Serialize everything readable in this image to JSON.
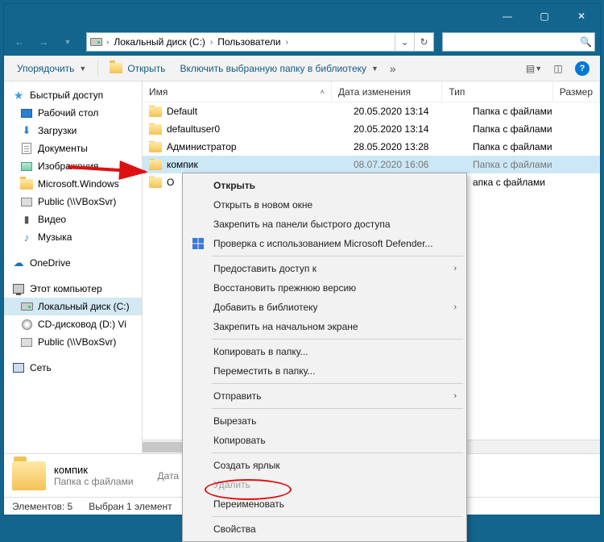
{
  "titlebar": {
    "min": "—",
    "max": "▢",
    "close": "✕"
  },
  "breadcrumbs": [
    "Локальный диск (C:)",
    "Пользователи"
  ],
  "search_placeholder": "",
  "toolbar": {
    "organize": "Упорядочить",
    "open": "Открыть",
    "include": "Включить выбранную папку в библиотеку",
    "overflow": "»"
  },
  "columns": {
    "name": "Имя",
    "date": "Дата изменения",
    "type": "Тип",
    "size": "Размер"
  },
  "rows": [
    {
      "name": "Default",
      "date": "20.05.2020 13:14",
      "type": "Папка с файлами"
    },
    {
      "name": "defaultuser0",
      "date": "20.05.2020 13:14",
      "type": "Папка с файлами"
    },
    {
      "name": "Администратор",
      "date": "28.05.2020 13:28",
      "type": "Папка с файлами"
    },
    {
      "name": "компик",
      "date": "08.07.2020 16:06",
      "type": "Папка с файлами",
      "selected": true
    },
    {
      "name": "О",
      "date": "",
      "type": "апка с файлами"
    }
  ],
  "sidebar": {
    "quick": {
      "label": "Быстрый доступ",
      "items": [
        "Рабочий стол",
        "Загрузки",
        "Документы",
        "Изображения",
        "Microsoft.Windows",
        "Public (\\\\VBoxSvr)",
        "Видео",
        "Музыка"
      ]
    },
    "onedrive": {
      "label": "OneDrive"
    },
    "thispc": {
      "label": "Этот компьютер",
      "items": [
        "Локальный диск (C:)",
        "CD-дисковод (D:) Vi",
        "Public (\\\\VBoxSvr)"
      ]
    },
    "network": {
      "label": "Сеть"
    }
  },
  "context": {
    "open": "Открыть",
    "open_new": "Открыть в новом окне",
    "pin_qa": "Закрепить на панели быстрого доступа",
    "defender": "Проверка с использованием Microsoft Defender...",
    "share": "Предоставить доступ к",
    "restore": "Восстановить прежнюю версию",
    "add_lib": "Добавить в библиотеку",
    "pin_start": "Закрепить на начальном экране",
    "copy_to": "Копировать в папку...",
    "move_to": "Переместить в папку...",
    "send_to": "Отправить",
    "cut": "Вырезать",
    "copy": "Копировать",
    "shortcut": "Создать ярлык",
    "delete": "Удалить",
    "rename": "Переименовать",
    "props": "Свойства"
  },
  "details": {
    "name": "компик",
    "type": "Папка с файлами",
    "date_label": "Дата"
  },
  "status": {
    "count": "Элементов: 5",
    "sel": "Выбран 1 элемент"
  }
}
